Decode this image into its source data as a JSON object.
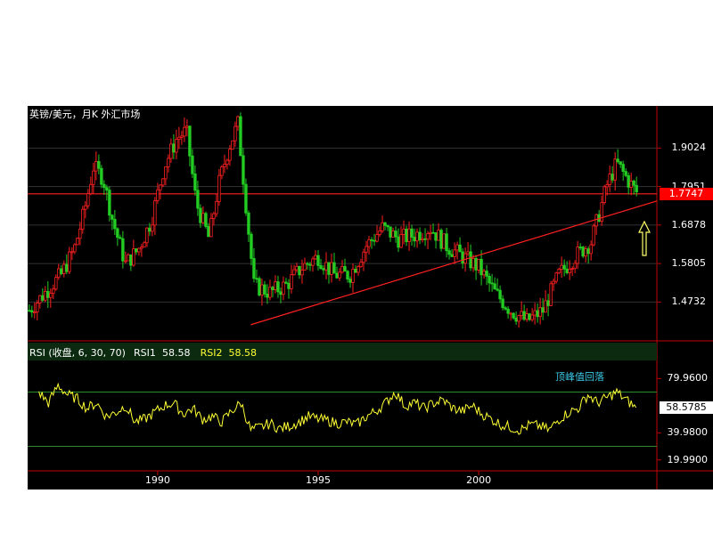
{
  "chart_data": {
    "type": "candlestick",
    "title": "英镑/美元，月K 外汇市场",
    "price_axis": {
      "ticks": [
        "1.9024",
        "1.7951",
        "1.6878",
        "1.5805",
        "1.4732"
      ],
      "tick_values": [
        1.9024,
        1.7951,
        1.6878,
        1.5805,
        1.4732
      ],
      "ylim": [
        1.37,
        2.0
      ],
      "current_value_label": "1.7747",
      "current_value": 1.7747,
      "horizontal_line_value": 1.7747
    },
    "x_axis": {
      "ticks": [
        "1990",
        "1995",
        "2000"
      ],
      "tick_values": [
        1990,
        1995,
        2000
      ],
      "xlim": [
        1985.95,
        2005.55
      ]
    },
    "trendline": {
      "start": [
        1992.9,
        1.41
      ],
      "end": [
        2005.55,
        1.755
      ]
    },
    "candles_summary": "monthly candles 1986-2004",
    "close_series": {
      "x": [
        1986.0,
        1986.5,
        1987.0,
        1987.4,
        1987.7,
        1988.0,
        1988.3,
        1988.6,
        1989.0,
        1989.4,
        1989.8,
        1990.2,
        1990.6,
        1990.9,
        1991.2,
        1991.6,
        1991.9,
        1992.2,
        1992.5,
        1992.8,
        1993.0,
        1993.5,
        1994.0,
        1994.5,
        1995.0,
        1995.5,
        1996.0,
        1996.5,
        1997.0,
        1997.5,
        1998.0,
        1998.5,
        1999.0,
        1999.5,
        2000.0,
        2000.5,
        2001.0,
        2001.5,
        2002.0,
        2002.5,
        2003.0,
        2003.5,
        2004.0,
        2004.3,
        2004.6,
        2004.9
      ],
      "y": [
        1.45,
        1.5,
        1.55,
        1.62,
        1.72,
        1.85,
        1.82,
        1.7,
        1.58,
        1.62,
        1.7,
        1.85,
        1.93,
        1.95,
        1.75,
        1.65,
        1.8,
        1.9,
        1.97,
        1.7,
        1.52,
        1.5,
        1.52,
        1.57,
        1.6,
        1.55,
        1.55,
        1.63,
        1.68,
        1.65,
        1.66,
        1.68,
        1.63,
        1.6,
        1.57,
        1.5,
        1.45,
        1.42,
        1.45,
        1.55,
        1.6,
        1.64,
        1.8,
        1.86,
        1.82,
        1.78
      ]
    },
    "rsi": {
      "label": "RSI (收盘, 6, 30, 70)",
      "rsi1_label": "RSI1",
      "rsi1_value": "58.58",
      "rsi2_label": "RSI2",
      "rsi2_value": "58.58",
      "ticks": [
        "79.9600",
        "39.9800",
        "19.9900"
      ],
      "tick_values": [
        79.96,
        39.98,
        19.99
      ],
      "ylim": [
        12,
        92
      ],
      "current_value_label": "58.5785",
      "x": [
        1986.3,
        1986.6,
        1986.9,
        1987.2,
        1987.5,
        1987.8,
        1988.1,
        1988.4,
        1988.7,
        1989.0,
        1989.3,
        1989.6,
        1989.9,
        1990.2,
        1990.5,
        1990.8,
        1991.1,
        1991.4,
        1991.7,
        1992.0,
        1992.3,
        1992.6,
        1992.9,
        1993.2,
        1993.5,
        1993.8,
        1994.1,
        1994.4,
        1994.7,
        1995.0,
        1995.3,
        1995.6,
        1995.9,
        1996.2,
        1996.5,
        1996.8,
        1997.1,
        1997.4,
        1997.7,
        1998.0,
        1998.3,
        1998.6,
        1998.9,
        1999.2,
        1999.5,
        1999.8,
        2000.1,
        2000.4,
        2000.7,
        2001.0,
        2001.3,
        2001.6,
        2001.9,
        2002.2,
        2002.5,
        2002.8,
        2003.1,
        2003.4,
        2003.7,
        2004.0,
        2004.3,
        2004.6,
        2004.9
      ],
      "y": [
        70,
        62,
        75,
        68,
        65,
        58,
        62,
        52,
        55,
        60,
        48,
        50,
        55,
        60,
        62,
        54,
        58,
        50,
        52,
        48,
        56,
        62,
        42,
        44,
        47,
        43,
        45,
        48,
        52,
        50,
        49,
        47,
        48,
        46,
        52,
        56,
        62,
        70,
        60,
        62,
        58,
        62,
        64,
        58,
        56,
        60,
        54,
        50,
        46,
        44,
        42,
        46,
        45,
        42,
        50,
        55,
        58,
        68,
        62,
        66,
        70,
        64,
        58.58
      ]
    },
    "annotation": "顶峰值回落"
  }
}
